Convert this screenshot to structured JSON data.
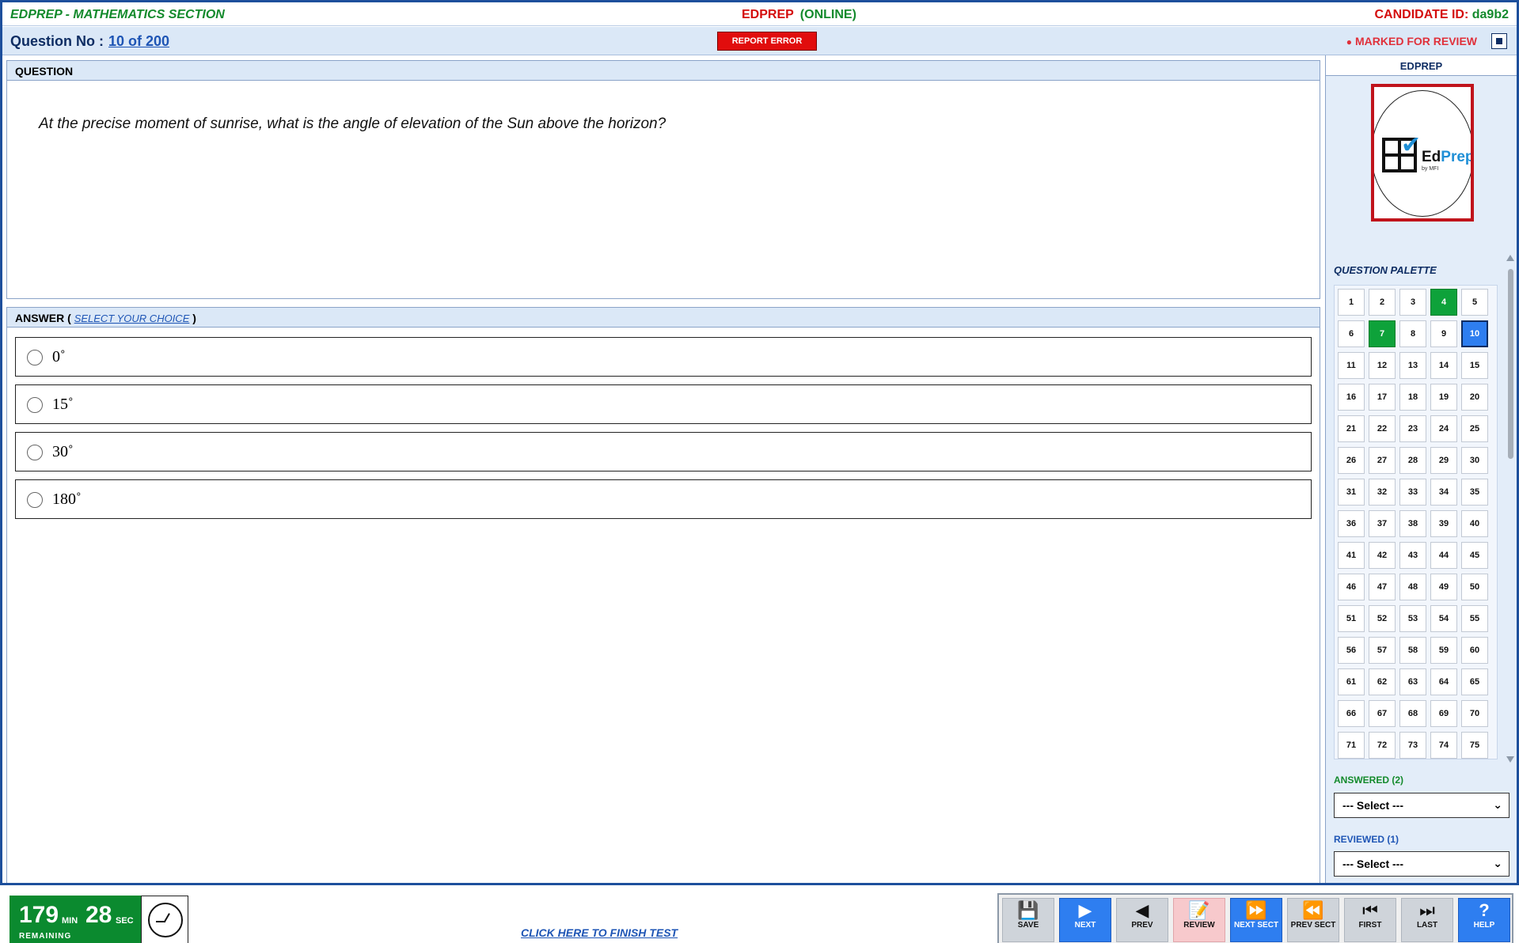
{
  "header": {
    "section_title": "EDPREP - MATHEMATICS SECTION",
    "exam_brand": "EDPREP",
    "exam_mode": "(ONLINE)",
    "candidate_label": "CANDIDATE ID:",
    "candidate_id": "da9b2"
  },
  "question_bar": {
    "label": "Question No :",
    "number": "10 of 200",
    "report_label": "REPORT ERROR",
    "marked_label": "MARKED FOR REVIEW"
  },
  "question": {
    "panel_title": "QUESTION",
    "text": "At the precise moment of sunrise, what is the angle of elevation of the Sun above the horizon?"
  },
  "answer": {
    "panel_title": "ANSWER",
    "instruction": "SELECT YOUR CHOICE",
    "options": [
      "0˚",
      "15˚",
      "30˚",
      "180˚"
    ]
  },
  "sidebar": {
    "head": "EDPREP",
    "logo": {
      "brand_a": "Ed",
      "brand_b": "Prep",
      "byline": "by MFI"
    },
    "palette_title": "QUESTION PALETTE",
    "answered_label": "ANSWERED (2)",
    "reviewed_label": "REVIEWED (1)",
    "select_placeholder": "--- Select ---"
  },
  "palette": {
    "count": 75,
    "answered": [
      4,
      7
    ],
    "current": 10,
    "colors": {
      "answered": "#0ea23a",
      "current": "#2e7ef0"
    }
  },
  "footer": {
    "minutes": "179",
    "min_unit": "MIN",
    "seconds": "28",
    "sec_unit": "SEC",
    "remaining": "REMAINING",
    "finish_link": "CLICK HERE TO FINISH TEST"
  },
  "nav_buttons": {
    "save": "SAVE",
    "next": "NEXT",
    "prev": "PREV",
    "review": "REVIEW",
    "next_sect": "NEXT SECT",
    "prev_sect": "PREV SECT",
    "first": "FIRST",
    "last": "LAST",
    "help": "HELP"
  },
  "icons": {
    "save": "floppy-disk-icon",
    "next": "play-right-icon",
    "prev": "play-left-icon",
    "review": "notepad-pencil-icon",
    "next_sect": "fast-forward-icon",
    "prev_sect": "rewind-icon",
    "first": "skip-first-icon",
    "last": "skip-last-icon",
    "help": "question-mark-icon"
  }
}
